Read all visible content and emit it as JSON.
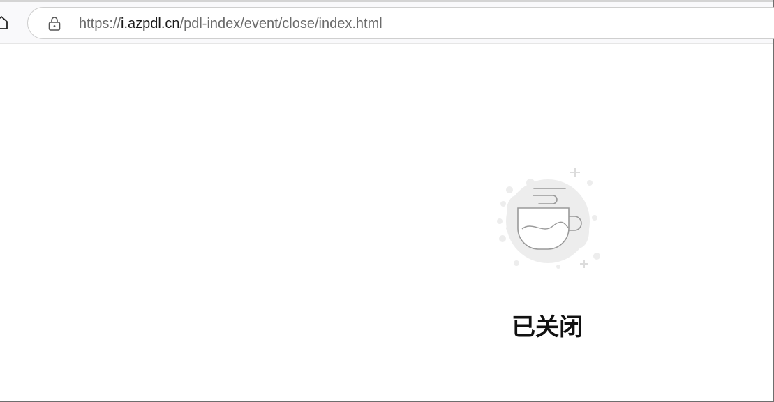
{
  "browser": {
    "address_bar": {
      "url_protocol": "https://",
      "url_domain": "i.azpdl.cn",
      "url_path": "/pdl-index/event/close/index.html"
    },
    "icons": {
      "home": "home-icon",
      "lock": "lock-icon"
    }
  },
  "page": {
    "illustration_icon": "coffee-cup-icon",
    "status_title": "已关闭"
  },
  "colors": {
    "url_dim": "#6b6b6b",
    "url_domain": "#1a1a1a",
    "illustration_blob": "#ededed",
    "illustration_stroke": "#9a9a9a",
    "title": "#111111"
  }
}
